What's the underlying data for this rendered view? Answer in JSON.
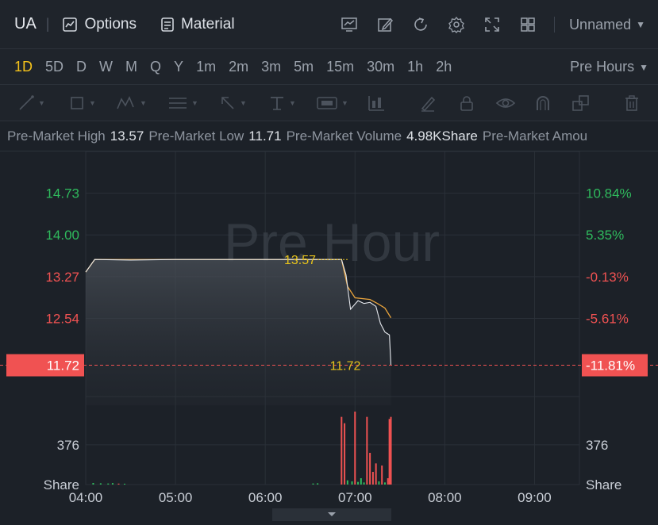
{
  "header": {
    "symbol": "UA",
    "options_label": "Options",
    "material_label": "Material",
    "layout_name": "Unnamed",
    "icons": [
      "indicator-icon",
      "draw-pencil-icon",
      "refresh-icon",
      "settings-gear-icon",
      "fullscreen-icon",
      "layout-grid-icon"
    ]
  },
  "intervals": [
    "1D",
    "5D",
    "D",
    "W",
    "M",
    "Q",
    "Y",
    "1m",
    "2m",
    "3m",
    "5m",
    "15m",
    "30m",
    "1h",
    "2h"
  ],
  "active_interval": "1D",
  "session_selector": "Pre Hours",
  "draw_tools": [
    "trend-line-tool-icon",
    "rectangle-tool-icon",
    "pattern-tool-icon",
    "fib-tool-icon",
    "arrow-tool-icon",
    "text-tool-icon",
    "price-label-tool-icon",
    "chart-type-icon",
    "brush-icon",
    "lock-icon",
    "eye-icon",
    "magnet-icon",
    "layers-icon",
    "trash-icon"
  ],
  "info": {
    "high_label": "Pre-Market High",
    "high_value": "13.57",
    "low_label": "Pre-Market Low",
    "low_value": "11.71",
    "volume_label": "Pre-Market Volume",
    "volume_value": "4.98KShare",
    "amount_label": "Pre-Market Amou"
  },
  "colors": {
    "up": "#2fba5d",
    "down": "#f05252",
    "price_line": "#e8a33c",
    "current_line": "#e6e9ee",
    "label_yellow": "#e6c21a",
    "current_bg": "#f05252"
  },
  "chart_data": {
    "type": "line",
    "watermark": "Pre Hour",
    "x_ticks": [
      "04:00",
      "05:00",
      "06:00",
      "07:00",
      "08:00",
      "09:00"
    ],
    "price_axis": {
      "ticks": [
        14.73,
        14.0,
        13.27,
        12.54
      ],
      "tick_labels": [
        "14.73",
        "14.00",
        "13.27",
        "12.54"
      ],
      "ylim": [
        11.02,
        15.46
      ]
    },
    "percent_axis": {
      "tick_labels": [
        "10.84%",
        "5.35%",
        "-0.13%",
        "-5.61%"
      ],
      "current_percent": "-11.81%"
    },
    "current_price": 11.72,
    "current_price_label": "11.72",
    "high_marker": 13.57,
    "high_marker_label": "13.57",
    "volume_axis": {
      "tick_label": "376",
      "unit_label": "Share",
      "max": 750
    },
    "series": [
      {
        "name": "price",
        "x": [
          "04:00",
          "04:06",
          "04:30",
          "05:00",
          "06:00",
          "06:30",
          "06:51",
          "06:54",
          "06:57",
          "07:02",
          "07:06",
          "07:10",
          "07:14",
          "07:17",
          "07:20",
          "07:23",
          "07:24"
        ],
        "values": [
          13.35,
          13.57,
          13.56,
          13.57,
          13.57,
          13.57,
          13.57,
          13.3,
          12.7,
          12.85,
          12.8,
          12.82,
          12.75,
          12.45,
          12.3,
          12.25,
          11.72
        ]
      },
      {
        "name": "average",
        "x": [
          "04:00",
          "04:06",
          "06:51",
          "06:55",
          "07:00",
          "07:10",
          "07:15",
          "07:20",
          "07:24"
        ],
        "values": [
          13.35,
          13.57,
          13.57,
          13.1,
          12.9,
          12.87,
          12.8,
          12.72,
          12.55
        ]
      }
    ],
    "volume": {
      "x": [
        "04:05",
        "04:10",
        "04:15",
        "04:18",
        "04:22",
        "04:26",
        "06:32",
        "06:35",
        "06:51",
        "06:53",
        "06:55",
        "06:58",
        "07:00",
        "07:02",
        "07:04",
        "07:06",
        "07:08",
        "07:10",
        "07:12",
        "07:14",
        "07:16",
        "07:18",
        "07:20",
        "07:22",
        "07:23",
        "07:24"
      ],
      "values": [
        15,
        12,
        10,
        14,
        9,
        8,
        10,
        12,
        640,
        580,
        40,
        30,
        690,
        25,
        60,
        20,
        640,
        300,
        120,
        200,
        30,
        180,
        20,
        60,
        620,
        640
      ],
      "colors": [
        "up",
        "up",
        "up",
        "up",
        "down",
        "up",
        "up",
        "up",
        "down",
        "down",
        "up",
        "up",
        "down",
        "up",
        "up",
        "up",
        "down",
        "down",
        "down",
        "down",
        "up",
        "down",
        "up",
        "down",
        "down",
        "down"
      ]
    }
  }
}
